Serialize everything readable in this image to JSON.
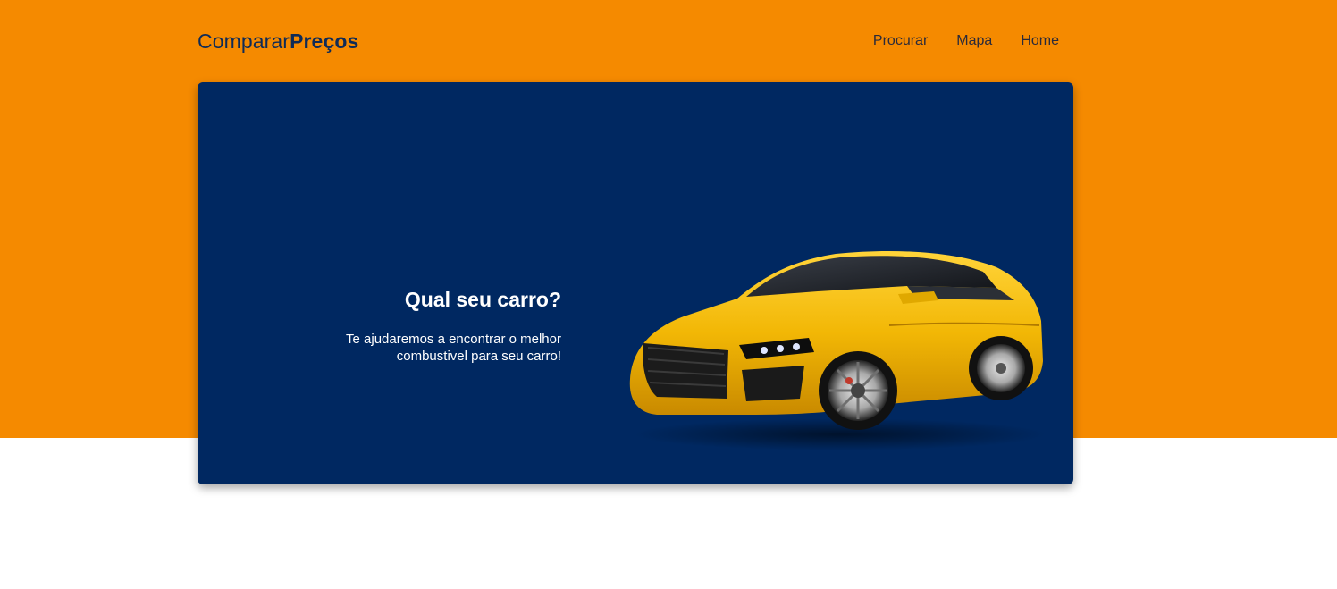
{
  "brand": {
    "light": "Comparar",
    "bold": "Preços"
  },
  "nav": {
    "items": [
      {
        "label": "Procurar"
      },
      {
        "label": "Mapa"
      },
      {
        "label": "Home"
      }
    ]
  },
  "hero": {
    "title": "Qual seu carro?",
    "subtitle_line1": "Te ajudaremos a encontrar o melhor",
    "subtitle_line2": "combustivel para seu carro!",
    "image_icon": "yellow-sports-car"
  },
  "colors": {
    "accent": "#f58a00",
    "hero_bg": "#002861",
    "brand_text": "#0f2b57",
    "car": "#f2b705"
  }
}
